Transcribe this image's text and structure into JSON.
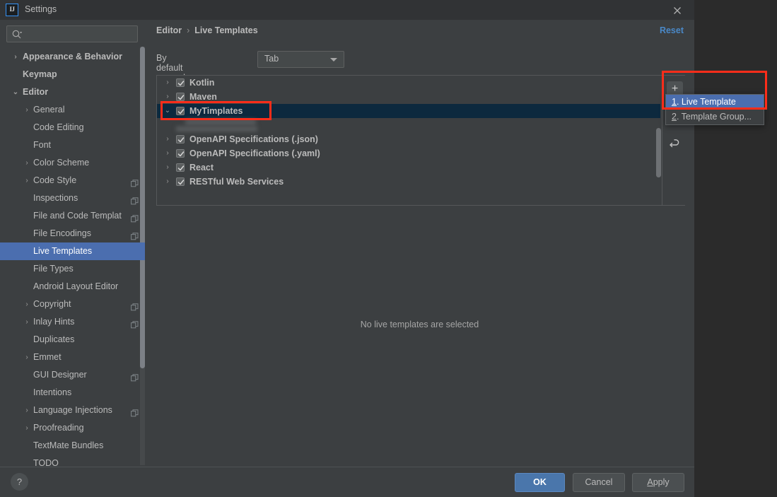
{
  "window": {
    "title": "Settings",
    "logo_text": "IJ",
    "close_icon": "close-icon"
  },
  "sidebar": {
    "search": {
      "value": "",
      "placeholder": ""
    },
    "items": [
      {
        "label": "Appearance & Behavior",
        "level": 0,
        "arrow": "›",
        "bold": true,
        "copy": false,
        "selected": false
      },
      {
        "label": "Keymap",
        "level": 0,
        "arrow": "",
        "bold": true,
        "copy": false,
        "selected": false
      },
      {
        "label": "Editor",
        "level": 0,
        "arrow": "⌄",
        "bold": true,
        "copy": false,
        "selected": false
      },
      {
        "label": "General",
        "level": 1,
        "arrow": "›",
        "bold": false,
        "copy": false,
        "selected": false
      },
      {
        "label": "Code Editing",
        "level": 1,
        "arrow": "",
        "bold": false,
        "copy": false,
        "selected": false
      },
      {
        "label": "Font",
        "level": 1,
        "arrow": "",
        "bold": false,
        "copy": false,
        "selected": false
      },
      {
        "label": "Color Scheme",
        "level": 1,
        "arrow": "›",
        "bold": false,
        "copy": false,
        "selected": false
      },
      {
        "label": "Code Style",
        "level": 1,
        "arrow": "›",
        "bold": false,
        "copy": true,
        "selected": false
      },
      {
        "label": "Inspections",
        "level": 1,
        "arrow": "",
        "bold": false,
        "copy": true,
        "selected": false
      },
      {
        "label": "File and Code Templat",
        "level": 1,
        "arrow": "",
        "bold": false,
        "copy": true,
        "selected": false
      },
      {
        "label": "File Encodings",
        "level": 1,
        "arrow": "",
        "bold": false,
        "copy": true,
        "selected": false
      },
      {
        "label": "Live Templates",
        "level": 1,
        "arrow": "",
        "bold": false,
        "copy": false,
        "selected": true
      },
      {
        "label": "File Types",
        "level": 1,
        "arrow": "",
        "bold": false,
        "copy": false,
        "selected": false
      },
      {
        "label": "Android Layout Editor",
        "level": 1,
        "arrow": "",
        "bold": false,
        "copy": false,
        "selected": false
      },
      {
        "label": "Copyright",
        "level": 1,
        "arrow": "›",
        "bold": false,
        "copy": true,
        "selected": false
      },
      {
        "label": "Inlay Hints",
        "level": 1,
        "arrow": "›",
        "bold": false,
        "copy": true,
        "selected": false
      },
      {
        "label": "Duplicates",
        "level": 1,
        "arrow": "",
        "bold": false,
        "copy": false,
        "selected": false
      },
      {
        "label": "Emmet",
        "level": 1,
        "arrow": "›",
        "bold": false,
        "copy": false,
        "selected": false
      },
      {
        "label": "GUI Designer",
        "level": 1,
        "arrow": "",
        "bold": false,
        "copy": true,
        "selected": false
      },
      {
        "label": "Intentions",
        "level": 1,
        "arrow": "",
        "bold": false,
        "copy": false,
        "selected": false
      },
      {
        "label": "Language Injections",
        "level": 1,
        "arrow": "›",
        "bold": false,
        "copy": true,
        "selected": false
      },
      {
        "label": "Proofreading",
        "level": 1,
        "arrow": "›",
        "bold": false,
        "copy": false,
        "selected": false
      },
      {
        "label": "TextMate Bundles",
        "level": 1,
        "arrow": "",
        "bold": false,
        "copy": false,
        "selected": false
      },
      {
        "label": "TODO",
        "level": 1,
        "arrow": "",
        "bold": false,
        "copy": false,
        "selected": false
      }
    ]
  },
  "main": {
    "breadcrumb": {
      "parent": "Editor",
      "separator": "›",
      "current": "Live Templates"
    },
    "reset_label": "Reset",
    "expand": {
      "label": "By default expand with",
      "selected": "Tab"
    },
    "templates": [
      {
        "label": "Kotlin",
        "arrow": "›",
        "checked": true,
        "selected": false
      },
      {
        "label": "Maven",
        "arrow": "›",
        "checked": true,
        "selected": false
      },
      {
        "label": "MyTimplates",
        "arrow": "⌄",
        "checked": true,
        "selected": true
      },
      {
        "label": "",
        "arrow": "",
        "checked": false,
        "selected": false
      },
      {
        "label": "OpenAPI Specifications (.json)",
        "arrow": "›",
        "checked": true,
        "selected": false
      },
      {
        "label": "OpenAPI Specifications (.yaml)",
        "arrow": "›",
        "checked": true,
        "selected": false
      },
      {
        "label": "React",
        "arrow": "›",
        "checked": true,
        "selected": false
      },
      {
        "label": "RESTful Web Services",
        "arrow": "›",
        "checked": true,
        "selected": false
      }
    ],
    "toolbar": {
      "add_label": "+",
      "add_icon": "plus-icon",
      "undo_icon": "undo-arrow-icon"
    },
    "popup_menu": {
      "items": [
        {
          "mnemonic": "1",
          "label": ". Live Template",
          "highlighted": true
        },
        {
          "mnemonic": "2",
          "label": ". Template Group...",
          "highlighted": false
        }
      ]
    },
    "empty_message": "No live templates are selected"
  },
  "footer": {
    "help_label": "?",
    "ok_label": "OK",
    "cancel_label": "Cancel",
    "apply_mnemonic": "A",
    "apply_rest": "pply"
  },
  "colors": {
    "dialog_bg": "#3c3f41",
    "titlebar_bg": "#313335",
    "outside_bg": "#2b2b2b",
    "accent_selection": "#4b6eaf",
    "list_selection": "#0d293e",
    "link_blue": "#4a88c7",
    "annotation_red": "#ff2d1a",
    "text": "#bbbbbb"
  }
}
